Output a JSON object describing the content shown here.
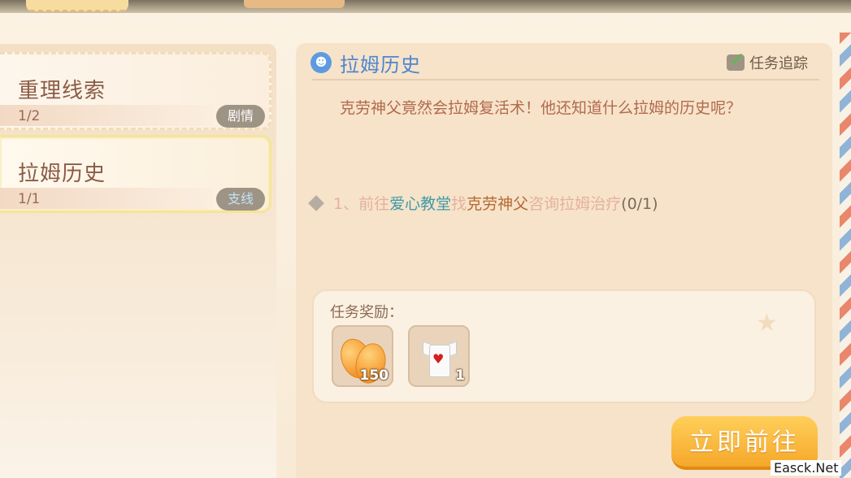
{
  "quest_list": [
    {
      "title": "重理线索",
      "progress": "1/2",
      "tag": "剧情"
    },
    {
      "title": "拉姆历史",
      "progress": "1/1",
      "tag": "支线"
    }
  ],
  "detail": {
    "title": "拉姆历史",
    "track_label": "任务追踪",
    "description": "克劳神父竟然会拉姆复活术！他还知道什么拉姆的历史呢？",
    "objective": {
      "prefix": "1、前往",
      "location": "爱心教堂",
      "mid": "找",
      "npc": "克劳神父",
      "suffix": "咨询拉姆治疗",
      "count": "(0/1)"
    }
  },
  "rewards": {
    "label": "任务奖励：",
    "items": [
      {
        "name": "orange",
        "count": "150"
      },
      {
        "name": "shirt",
        "count": "1"
      }
    ]
  },
  "go_button": "立即前往",
  "watermark": "Easck.Net"
}
